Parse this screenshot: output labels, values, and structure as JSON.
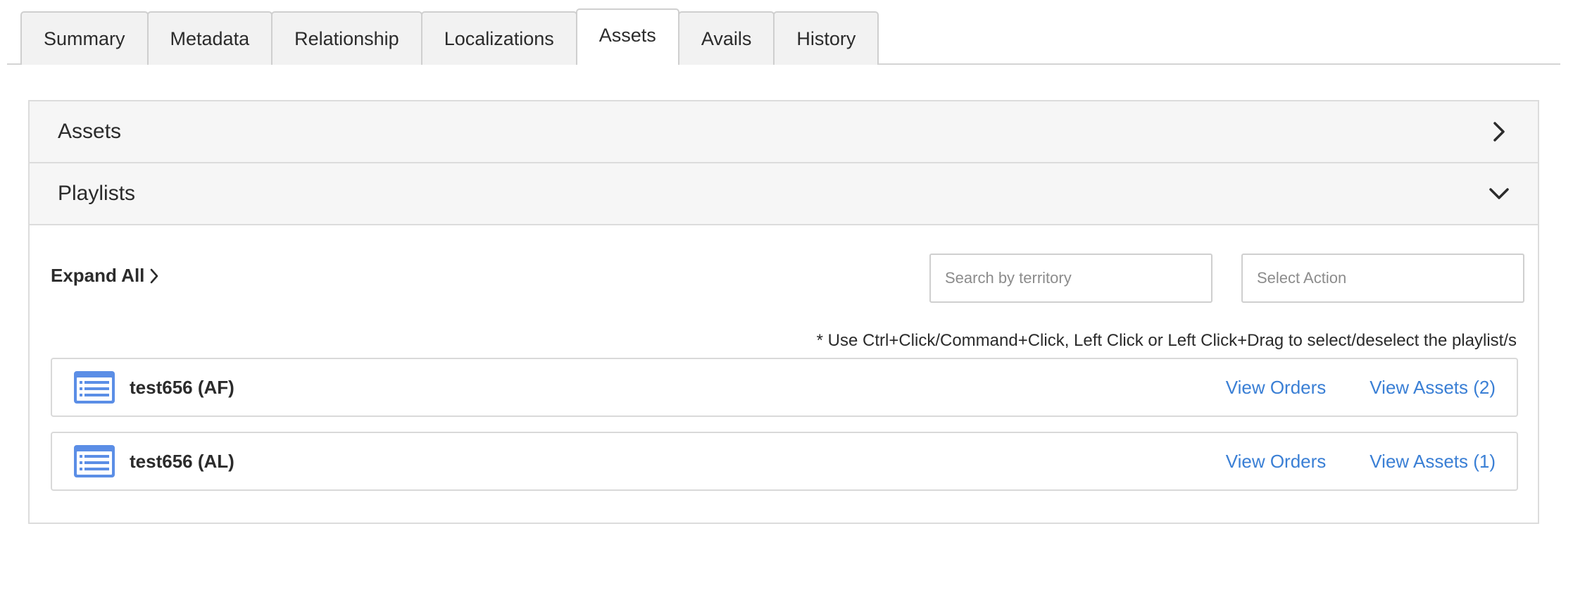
{
  "tabs": [
    {
      "label": "Summary",
      "active": false
    },
    {
      "label": "Metadata",
      "active": false
    },
    {
      "label": "Relationship",
      "active": false
    },
    {
      "label": "Localizations",
      "active": false
    },
    {
      "label": "Assets",
      "active": true
    },
    {
      "label": "Avails",
      "active": false
    },
    {
      "label": "History",
      "active": false
    }
  ],
  "sections": {
    "assets": {
      "title": "Assets",
      "expanded": false,
      "icon": "chevron-right-icon"
    },
    "playlists": {
      "title": "Playlists",
      "expanded": true,
      "icon": "chevron-down-icon"
    }
  },
  "playlists_panel": {
    "expand_all_label": "Expand All",
    "search_placeholder": "Search by territory",
    "select_action_placeholder": "Select Action",
    "hint": "* Use Ctrl+Click/Command+Click, Left Click or Left Click+Drag to select/deselect the playlist/s",
    "items": [
      {
        "name": "test656 (AF)",
        "orders_label": "View Orders",
        "assets_label": "View Assets (2)",
        "icon": "playlist-icon"
      },
      {
        "name": "test656 (AL)",
        "orders_label": "View Orders",
        "assets_label": "View Assets (1)",
        "icon": "playlist-icon"
      }
    ]
  },
  "colors": {
    "link": "#3a7fd5",
    "icon_blue": "#5b8ee6",
    "header_bg": "#f6f6f6",
    "border": "#dcdcdc"
  }
}
